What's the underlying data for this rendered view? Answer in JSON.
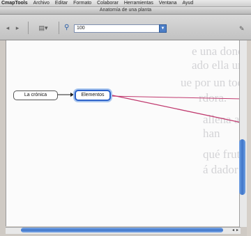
{
  "menubar": {
    "items": [
      "CmapTools",
      "Archivo",
      "Editar",
      "Formato",
      "Colaborar",
      "Herramientas",
      "Ventana",
      "Ayud"
    ]
  },
  "window": {
    "title": "Anatomía de una planta"
  },
  "toolbar": {
    "zoom_value": "100"
  },
  "ghost_text": [
    "e una doncella exquis, una da",
    "ado ella uno la hechura qu",
    "ue por un tocado por su padre, re",
    "rdora.",
    "allena al pie del árbol, que era",
    "han",
    "qué frutos son los que produce",
    "á dador de cada uno de la"
  ],
  "concepts": {
    "left": "La crónica",
    "right": "Elementos"
  },
  "colors": {
    "accent": "#2d62c8",
    "link_line": "#c0396e"
  }
}
